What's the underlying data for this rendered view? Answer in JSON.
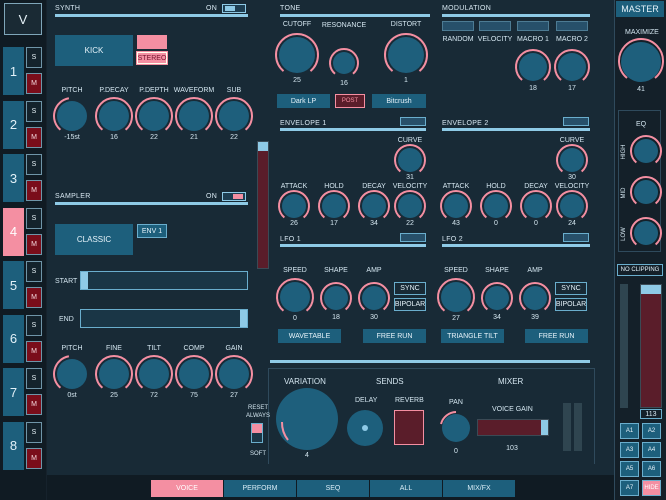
{
  "sidebar": {
    "v_label": "V",
    "voices": [
      {
        "num": "1",
        "s": "S",
        "m": "M"
      },
      {
        "num": "2",
        "s": "S",
        "m": "M"
      },
      {
        "num": "3",
        "s": "S",
        "m": "M"
      },
      {
        "num": "4",
        "s": "S",
        "m": "M"
      },
      {
        "num": "5",
        "s": "S",
        "m": "M"
      },
      {
        "num": "6",
        "s": "S",
        "m": "M"
      },
      {
        "num": "7",
        "s": "S",
        "m": "M"
      },
      {
        "num": "8",
        "s": "S",
        "m": "M"
      }
    ],
    "selected_voice": "4"
  },
  "synth": {
    "title": "SYNTH",
    "on_label": "ON",
    "preset": "KICK",
    "stereo": "STEREO",
    "knobs": [
      {
        "label": "PITCH",
        "value": "-15st"
      },
      {
        "label": "P.DECAY",
        "value": "16"
      },
      {
        "label": "P.DEPTH",
        "value": "22"
      },
      {
        "label": "WAVEFORM",
        "value": "21"
      },
      {
        "label": "SUB",
        "value": "22"
      }
    ]
  },
  "sampler": {
    "title": "SAMPLER",
    "on_label": "ON",
    "preset": "CLASSIC",
    "env": "ENV 1",
    "start_label": "START",
    "end_label": "END",
    "knobs": [
      {
        "label": "PITCH",
        "value": "0st"
      },
      {
        "label": "FINE",
        "value": "25"
      },
      {
        "label": "TILT",
        "value": "72"
      },
      {
        "label": "COMP",
        "value": "75"
      },
      {
        "label": "GAIN",
        "value": "27"
      }
    ]
  },
  "tone": {
    "title": "TONE",
    "knobs": [
      {
        "label": "CUTOFF",
        "value": "25"
      },
      {
        "label": "RESONANCE",
        "value": "16"
      },
      {
        "label": "DISTORT",
        "value": "1"
      }
    ],
    "filter": "Dark LP",
    "post": "POST",
    "dist_type": "Bitcrush"
  },
  "modulation": {
    "title": "MODULATION",
    "slots": [
      {
        "label": "RANDOM",
        "value": ""
      },
      {
        "label": "VELOCITY",
        "value": ""
      },
      {
        "label": "MACRO 1",
        "value": "18"
      },
      {
        "label": "MACRO 2",
        "value": "17"
      }
    ]
  },
  "env1": {
    "title": "ENVELOPE 1",
    "curve_label": "CURVE",
    "curve_value": "31",
    "knobs": [
      {
        "label": "ATTACK",
        "value": "26"
      },
      {
        "label": "HOLD",
        "value": "17"
      },
      {
        "label": "DECAY",
        "value": "34"
      },
      {
        "label": "VELOCITY",
        "value": "22"
      }
    ]
  },
  "env2": {
    "title": "ENVELOPE 2",
    "curve_label": "CURVE",
    "curve_value": "30",
    "knobs": [
      {
        "label": "ATTACK",
        "value": "43"
      },
      {
        "label": "HOLD",
        "value": "0"
      },
      {
        "label": "DECAY",
        "value": "0"
      },
      {
        "label": "VELOCITY",
        "value": "24"
      }
    ]
  },
  "lfo1": {
    "title": "LFO 1",
    "knobs": [
      {
        "label": "SPEED",
        "value": "0"
      },
      {
        "label": "SHAPE",
        "value": "18"
      },
      {
        "label": "AMP",
        "value": "30"
      }
    ],
    "sync": "SYNC",
    "bipolar": "BIPOLAR",
    "shape_name": "WAVETABLE",
    "mode": "FREE RUN"
  },
  "lfo2": {
    "title": "LFO 2",
    "knobs": [
      {
        "label": "SPEED",
        "value": "27"
      },
      {
        "label": "SHAPE",
        "value": "34"
      },
      {
        "label": "AMP",
        "value": "39"
      }
    ],
    "sync": "SYNC",
    "bipolar": "BIPOLAR",
    "shape_name": "TRIANGLE TILT",
    "mode": "FREE RUN"
  },
  "bottom": {
    "variation": "VARIATION",
    "variation_value": "4",
    "reset_always": "RESET ALWAYS",
    "soft": "SOFT",
    "sends": "SENDS",
    "delay": "DELAY",
    "reverb": "REVERB",
    "mixer": "MIXER",
    "pan": "PAN",
    "pan_value": "0",
    "voice_gain": "VOICE GAIN",
    "voice_gain_value": "103"
  },
  "master": {
    "title": "MASTER",
    "maximize": "MAXIMIZE",
    "maximize_value": "41",
    "eq": "EQ",
    "eq_bands": [
      "HIGH",
      "MID",
      "LOW"
    ],
    "no_clipping": "NO CLIPPING",
    "level": "113",
    "scenes": [
      "A1",
      "A2",
      "A3",
      "A4",
      "A5",
      "A6",
      "A7",
      "HIDE"
    ]
  },
  "tabs": [
    "VOICE",
    "PERFORM",
    "SEQ",
    "ALL",
    "MIX/FX"
  ],
  "active_tab": "VOICE",
  "colors": {
    "accent": "#f48fa2",
    "bar": "#8ecae6",
    "knob": "#1e5f7c",
    "button": "#1d5f7c",
    "bg": "#16222c"
  }
}
